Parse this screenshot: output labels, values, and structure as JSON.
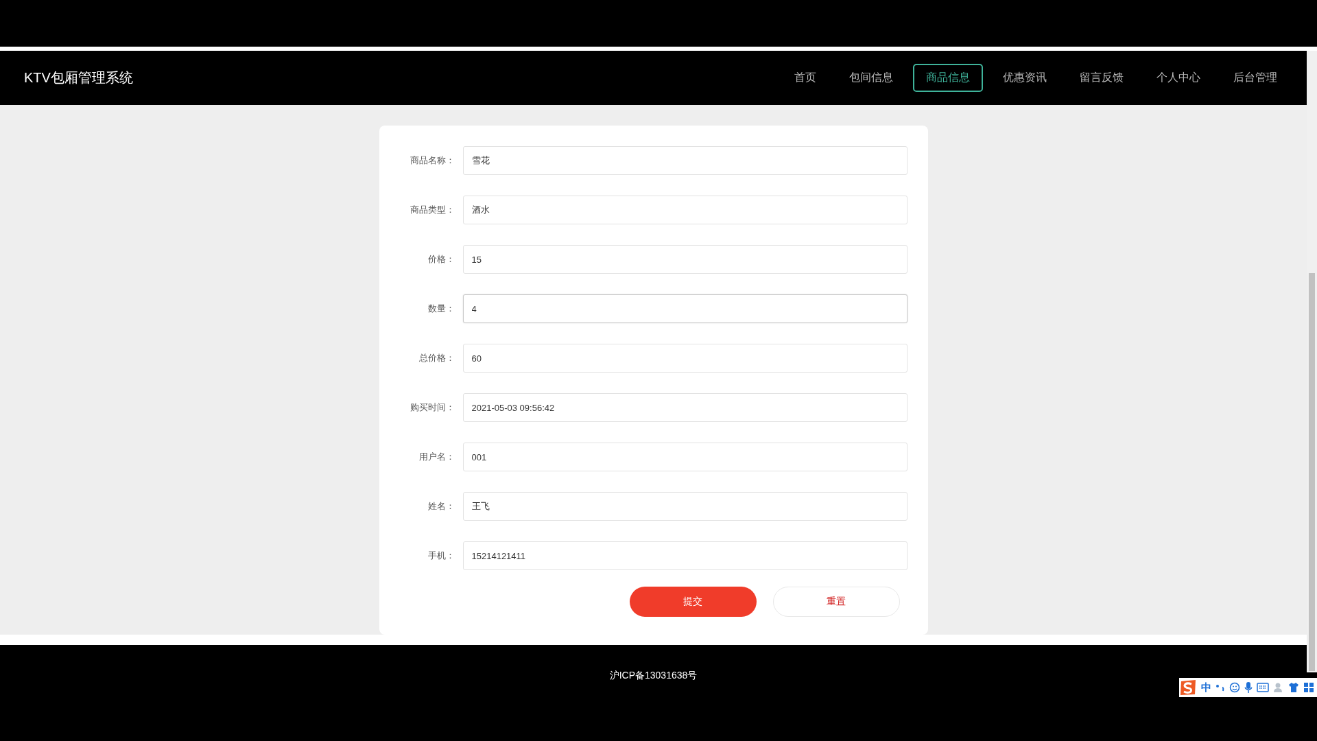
{
  "header": {
    "title": "KTV包厢管理系统",
    "nav": [
      {
        "label": "首页",
        "selected": false
      },
      {
        "label": "包间信息",
        "selected": false
      },
      {
        "label": "商品信息",
        "selected": true
      },
      {
        "label": "优惠资讯",
        "selected": false
      },
      {
        "label": "留言反馈",
        "selected": false
      },
      {
        "label": "个人中心",
        "selected": false
      },
      {
        "label": "后台管理",
        "selected": false
      }
    ]
  },
  "form": {
    "fields": [
      {
        "label": "商品名称：",
        "value": "雪花",
        "focused": false
      },
      {
        "label": "商品类型：",
        "value": "酒水",
        "focused": false
      },
      {
        "label": "价格：",
        "value": "15",
        "focused": false
      },
      {
        "label": "数量：",
        "value": "4",
        "focused": true
      },
      {
        "label": "总价格：",
        "value": "60",
        "focused": false
      },
      {
        "label": "购买时间：",
        "value": "2021-05-03 09:56:42",
        "focused": false
      },
      {
        "label": "用户名：",
        "value": "001",
        "focused": false
      },
      {
        "label": "姓名：",
        "value": "王飞",
        "focused": false
      },
      {
        "label": "手机：",
        "value": "15214121411",
        "focused": false
      }
    ],
    "buttons": [
      {
        "label": "提交",
        "kind": "primary"
      },
      {
        "label": "重置",
        "kind": "secondary"
      }
    ]
  },
  "footer": {
    "text": "沪ICP备13031638号"
  },
  "ime_toolbar": {
    "mode": "中"
  }
}
